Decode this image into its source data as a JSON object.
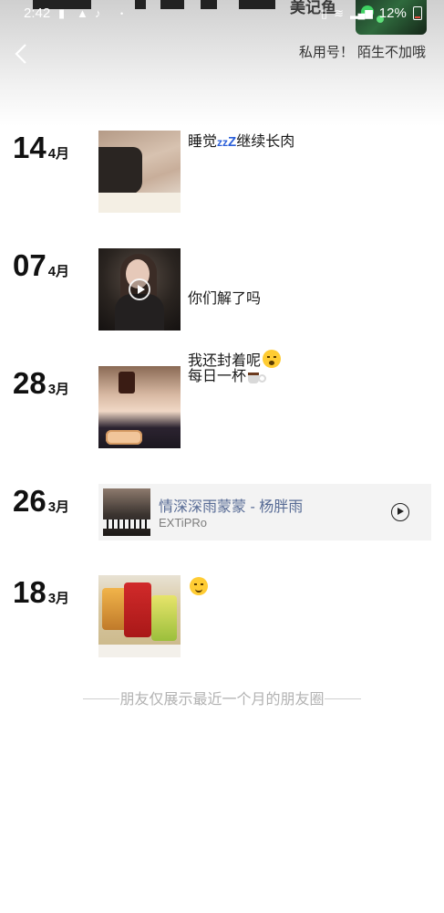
{
  "status_bar": {
    "time": "2:42",
    "battery": "12%"
  },
  "header": {
    "nickname": "美记鱼",
    "signature": "私用号！ 陌生不加哦"
  },
  "posts": [
    {
      "day": "14",
      "month": "4月",
      "type": "image",
      "text": "睡觉",
      "text_suffix": "继续长肉",
      "thumb": "sleeping-photo"
    },
    {
      "day": "07",
      "month": "4月",
      "type": "video",
      "text_line1": "你们解了吗",
      "text_line2": "我还封着呢",
      "thumb": "video-thumbnail"
    },
    {
      "day": "28",
      "month": "3月",
      "type": "image",
      "text": "每日一杯",
      "thumb": "drink-photo"
    },
    {
      "day": "26",
      "month": "3月",
      "type": "music",
      "song": "情深深雨蒙蒙 - 杨胖雨",
      "artist": "EXTiPRo"
    },
    {
      "day": "18",
      "month": "3月",
      "type": "image",
      "text": "",
      "thumb": "snacks-photo"
    }
  ],
  "footer": {
    "note": "朋友仅展示最近一个月的朋友圈"
  },
  "colors": {
    "link_blue": "#576b95",
    "footer_gray": "#b2b2b2",
    "music_card_bg": "#f3f3f3"
  }
}
